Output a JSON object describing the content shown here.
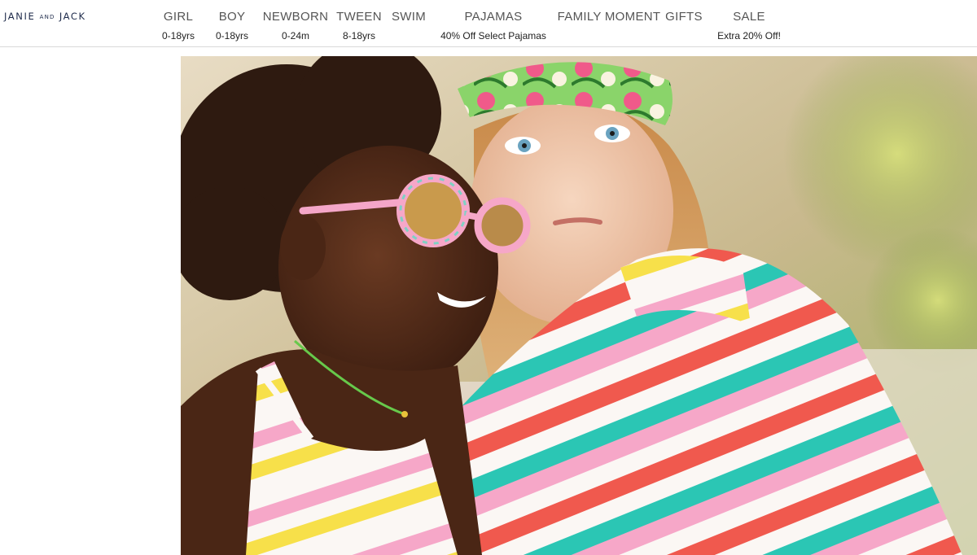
{
  "brand": {
    "logo_word_1": "JANIE",
    "logo_word_and": "AND",
    "logo_word_2": "JACK"
  },
  "nav": [
    {
      "label": "GIRL",
      "sub": "0-18yrs"
    },
    {
      "label": "BOY",
      "sub": "0-18yrs"
    },
    {
      "label": "NEWBORN",
      "sub": "0-24m"
    },
    {
      "label": "TWEEN",
      "sub": "8-18yrs"
    },
    {
      "label": "SWIM",
      "sub": ""
    },
    {
      "label": "PAJAMAS",
      "sub": "40% Off Select Pajamas"
    },
    {
      "label": "FAMILY MOMENT",
      "sub": ""
    },
    {
      "label": "GIFTS",
      "sub": ""
    },
    {
      "label": "SALE",
      "sub": "Extra 20% Off!"
    }
  ],
  "hero": {
    "colors": {
      "pink": "#f6a7c8",
      "yellow": "#f7e04a",
      "red": "#f0594e",
      "teal": "#2bc6b4",
      "white": "#fbf7f4",
      "green_bokeh": "#7ea03c"
    }
  }
}
